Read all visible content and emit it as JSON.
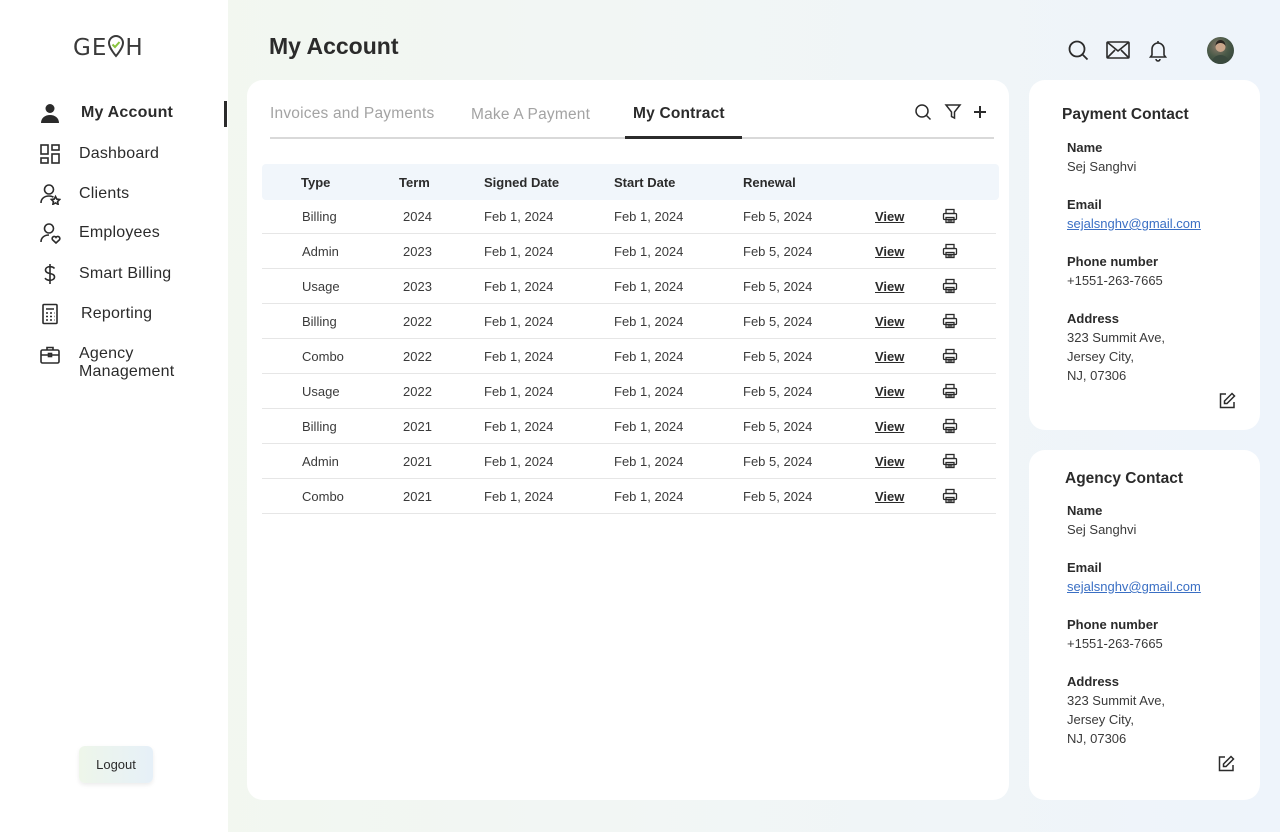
{
  "brand": {
    "logo_text_1": "GE",
    "logo_text_2": "H",
    "accent": "#8ac43f"
  },
  "sidebar": {
    "items": [
      {
        "label": "My Account",
        "icon": "user-icon",
        "active": true
      },
      {
        "label": "Dashboard",
        "icon": "dashboard-icon"
      },
      {
        "label": "Clients",
        "icon": "clients-icon"
      },
      {
        "label": "Employees",
        "icon": "employees-icon"
      },
      {
        "label": "Smart Billing",
        "icon": "dollar-icon"
      },
      {
        "label": "Reporting",
        "icon": "report-icon"
      },
      {
        "label": "Agency Management",
        "label_line1": "Agency",
        "label_line2": "Management",
        "icon": "briefcase-icon"
      }
    ],
    "logout_label": "Logout"
  },
  "header": {
    "title": "My Account",
    "icons": [
      "search-icon",
      "mail-icon",
      "bell-icon",
      "avatar"
    ]
  },
  "main": {
    "tabs": [
      {
        "label": "Invoices and Payments"
      },
      {
        "label": "Make A Payment"
      },
      {
        "label": "My Contract",
        "active": true
      }
    ],
    "tools": [
      "search-icon",
      "filter-icon",
      "plus-icon"
    ],
    "table": {
      "headers": [
        "Type",
        "Term",
        "Signed Date",
        "Start Date",
        "Renewal"
      ],
      "rows": [
        {
          "type": "Billing",
          "term": "2024",
          "signed": "Feb 1, 2024",
          "start": "Feb 1, 2024",
          "renewal": "Feb 5, 2024",
          "action": "View"
        },
        {
          "type": "Admin",
          "term": "2023",
          "signed": "Feb 1, 2024",
          "start": "Feb 1, 2024",
          "renewal": "Feb 5, 2024",
          "action": "View"
        },
        {
          "type": "Usage",
          "term": "2023",
          "signed": "Feb 1, 2024",
          "start": "Feb 1, 2024",
          "renewal": "Feb 5, 2024",
          "action": "View"
        },
        {
          "type": "Billing",
          "term": "2022",
          "signed": "Feb 1, 2024",
          "start": "Feb 1, 2024",
          "renewal": "Feb 5, 2024",
          "action": "View"
        },
        {
          "type": "Combo",
          "term": "2022",
          "signed": "Feb 1, 2024",
          "start": "Feb 1, 2024",
          "renewal": "Feb 5, 2024",
          "action": "View"
        },
        {
          "type": "Usage",
          "term": "2022",
          "signed": "Feb 1, 2024",
          "start": "Feb 1, 2024",
          "renewal": "Feb 5, 2024",
          "action": "View"
        },
        {
          "type": "Billing",
          "term": "2021",
          "signed": "Feb 1, 2024",
          "start": "Feb 1, 2024",
          "renewal": "Feb 5, 2024",
          "action": "View"
        },
        {
          "type": "Admin",
          "term": "2021",
          "signed": "Feb 1, 2024",
          "start": "Feb 1, 2024",
          "renewal": "Feb 5, 2024",
          "action": "View"
        },
        {
          "type": "Combo",
          "term": "2021",
          "signed": "Feb 1, 2024",
          "start": "Feb 1, 2024",
          "renewal": "Feb 5, 2024",
          "action": "View"
        }
      ]
    }
  },
  "payment_contact": {
    "title": "Payment Contact",
    "name_label": "Name",
    "name": "Sej Sanghvi",
    "email_label": "Email",
    "email": "sejalsnghv@gmail.com",
    "phone_label": "Phone number",
    "phone": "+1551-263-7665",
    "address_label": "Address",
    "address_line1": "323 Summit Ave,",
    "address_line2": "Jersey City,",
    "address_line3": "NJ, 07306"
  },
  "agency_contact": {
    "title": "Agency Contact",
    "name_label": "Name",
    "name": "Sej Sanghvi",
    "email_label": "Email",
    "email": "sejalsnghv@gmail.com",
    "phone_label": "Phone number",
    "phone": "+1551-263-7665",
    "address_label": "Address",
    "address_line1": "323 Summit Ave,",
    "address_line2": "Jersey City,",
    "address_line3": "NJ, 07306"
  }
}
